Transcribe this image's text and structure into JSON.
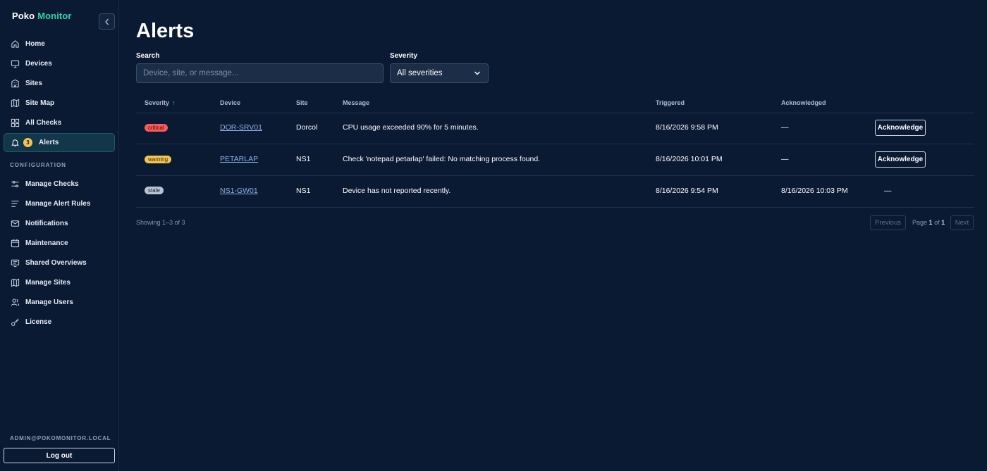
{
  "brand": {
    "part1": "Poko",
    "part2": "Monitor"
  },
  "sidebar": {
    "main_items": [
      {
        "label": "Home",
        "icon": "home-icon"
      },
      {
        "label": "Devices",
        "icon": "monitor-icon"
      },
      {
        "label": "Sites",
        "icon": "building-icon"
      },
      {
        "label": "Site Map",
        "icon": "map-icon"
      },
      {
        "label": "All Checks",
        "icon": "grid-icon"
      },
      {
        "label": "Alerts",
        "icon": "bell-icon",
        "badge": "3",
        "active": true
      }
    ],
    "section_label": "CONFIGURATION",
    "config_items": [
      {
        "label": "Manage Checks",
        "icon": "sliders-icon"
      },
      {
        "label": "Manage Alert Rules",
        "icon": "list-icon"
      },
      {
        "label": "Notifications",
        "icon": "mail-icon"
      },
      {
        "label": "Maintenance",
        "icon": "calendar-icon"
      },
      {
        "label": "Shared Overviews",
        "icon": "screen-share-icon"
      },
      {
        "label": "Manage Sites",
        "icon": "map-icon"
      },
      {
        "label": "Manage Users",
        "icon": "users-icon"
      },
      {
        "label": "License",
        "icon": "key-icon"
      }
    ],
    "user_email": "ADMIN@POKOMONITOR.LOCAL",
    "logout_label": "Log out"
  },
  "page": {
    "title": "Alerts",
    "search_label": "Search",
    "search_placeholder": "Device, site, or message...",
    "severity_label": "Severity",
    "severity_selected": "All severities"
  },
  "table": {
    "headers": {
      "severity": "Severity",
      "sort_indicator": "↑",
      "device": "Device",
      "site": "Site",
      "message": "Message",
      "triggered": "Triggered",
      "acknowledged": "Acknowledged"
    },
    "rows": [
      {
        "severity": "critical",
        "device": "DOR-SRV01",
        "site": "Dorcol",
        "message": "CPU usage exceeded 90% for 5 minutes.",
        "triggered": "8/16/2026 9:58 PM",
        "acknowledged": "—",
        "action": "Acknowledge"
      },
      {
        "severity": "warning",
        "device": "PETARLAP",
        "site": "NS1",
        "message": "Check 'notepad petarlap' failed: No matching process found.",
        "triggered": "8/16/2026 10:01 PM",
        "acknowledged": "—",
        "action": "Acknowledge"
      },
      {
        "severity": "stale",
        "device": "NS1-GW01",
        "site": "NS1",
        "message": "Device has not reported recently.",
        "triggered": "8/16/2026 9:54 PM",
        "acknowledged": "8/16/2026 10:03 PM",
        "action": "—"
      }
    ]
  },
  "pagination": {
    "showing": "Showing 1–3 of 3",
    "previous": "Previous",
    "page_prefix": "Page",
    "current": "1",
    "of": "of",
    "total": "1",
    "next": "Next"
  },
  "colors": {
    "background": "#0b1a33",
    "brand_accent": "#2fd3a5",
    "critical": "#ff5a5a",
    "warning": "#f5c451",
    "stale": "#b9c3d2"
  }
}
